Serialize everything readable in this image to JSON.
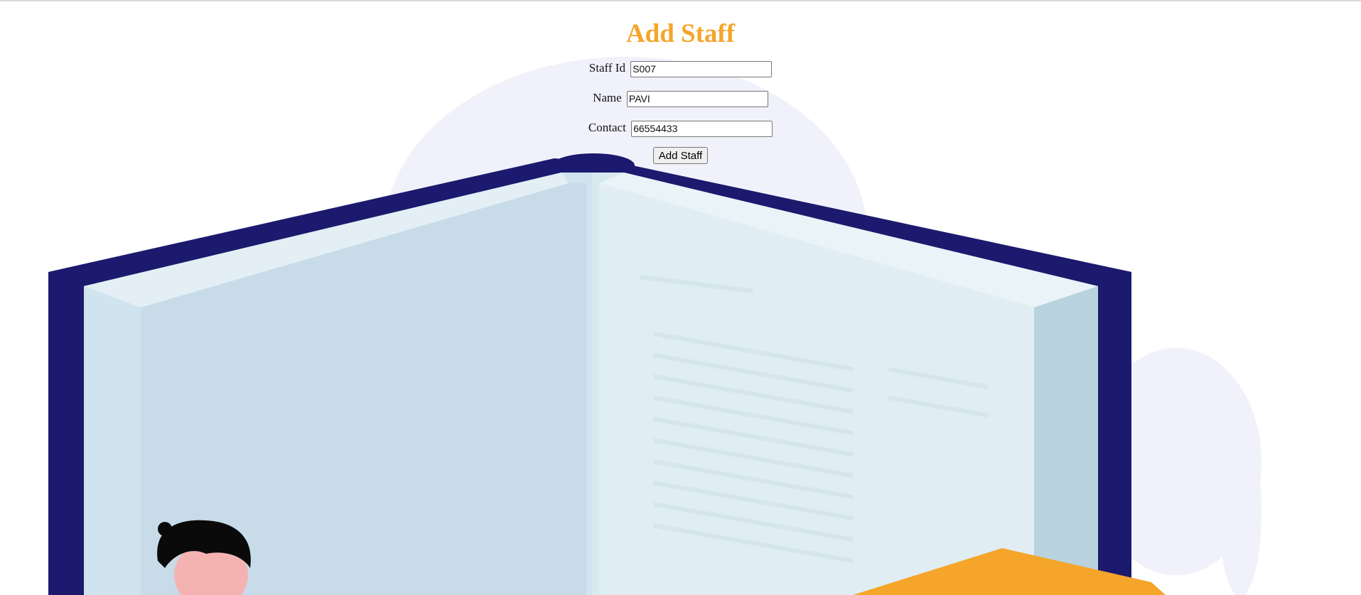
{
  "page": {
    "title": "Add Staff"
  },
  "form": {
    "fields": [
      {
        "label": "Staff Id",
        "value": "S007"
      },
      {
        "label": "Name",
        "value": "PAVI"
      },
      {
        "label": "Contact",
        "value": "66554433"
      }
    ],
    "submit_label": "Add Staff"
  },
  "colors": {
    "title": "#f5a52a",
    "book_cover": "#1b1a6e",
    "page_left": "#c9dfe9",
    "page_right": "#dbeaf0",
    "blob": "#f1f1fb",
    "accent_orange": "#f5a52a"
  },
  "illustration": {
    "icon": "open-book-illustration"
  }
}
